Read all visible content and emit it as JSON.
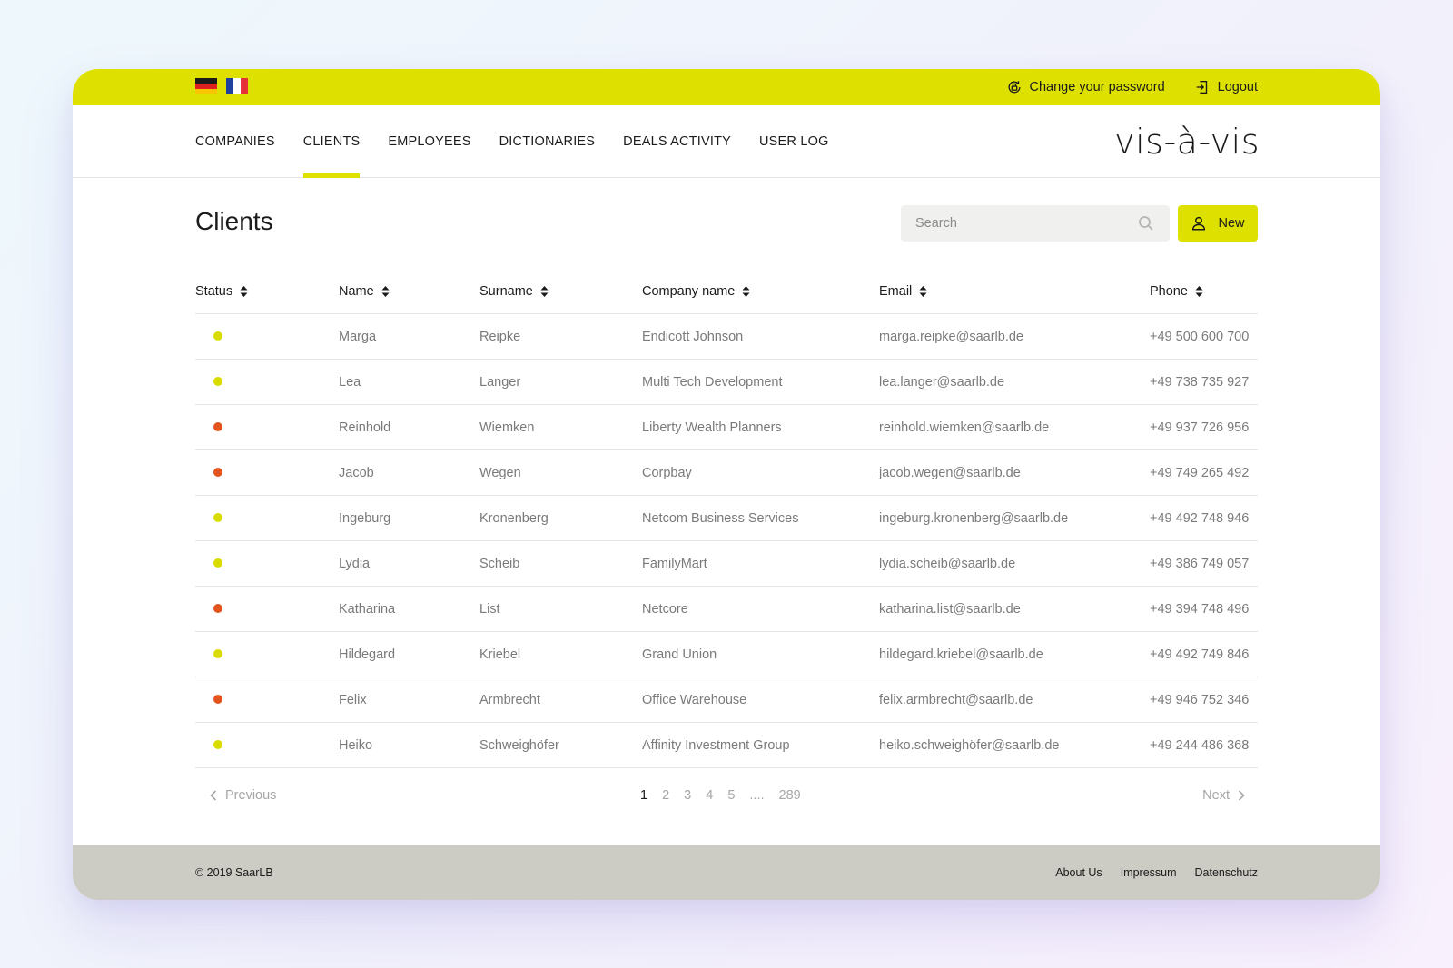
{
  "colors": {
    "accent": "#dee100",
    "status_active": "#d9dc00",
    "status_inactive": "#e2541e",
    "footer_bg": "#cccbc4",
    "muted_text": "#7a7a7a"
  },
  "topbar": {
    "languages": [
      {
        "code": "de",
        "icon": "german-flag-icon"
      },
      {
        "code": "fr",
        "icon": "french-flag-icon"
      }
    ],
    "change_password_label": "Change your password",
    "change_password_icon": "lock-refresh-icon",
    "logout_label": "Logout",
    "logout_icon": "logout-icon"
  },
  "nav": {
    "items": [
      "COMPANIES",
      "CLIENTS",
      "EMPLOYEES",
      "DICTIONARIES",
      "DEALS ACTIVITY",
      "USER LOG"
    ],
    "active": "CLIENTS"
  },
  "logo": "vis-à-vis",
  "page": {
    "title": "Clients",
    "search_placeholder": "Search",
    "search_value": "",
    "new_button_label": "New",
    "new_button_icon": "user-icon"
  },
  "table": {
    "columns": [
      "Status",
      "Name",
      "Surname",
      "Company name",
      "Email",
      "Phone"
    ],
    "sort_icon": "sort-icon",
    "rows": [
      {
        "status": "active",
        "name": "Marga",
        "surname": "Reipke",
        "company": "Endicott Johnson",
        "email": "marga.reipke@saarlb.de",
        "phone": "+49 500 600 700"
      },
      {
        "status": "active",
        "name": "Lea",
        "surname": "Langer",
        "company": "Multi Tech Development",
        "email": "lea.langer@saarlb.de",
        "phone": "+49 738 735 927"
      },
      {
        "status": "inactive",
        "name": "Reinhold",
        "surname": "Wiemken",
        "company": "Liberty Wealth Planners",
        "email": "reinhold.wiemken@saarlb.de",
        "phone": "+49 937 726 956"
      },
      {
        "status": "inactive",
        "name": "Jacob",
        "surname": "Wegen",
        "company": "Corpbay",
        "email": "jacob.wegen@saarlb.de",
        "phone": "+49 749 265 492"
      },
      {
        "status": "active",
        "name": "Ingeburg",
        "surname": "Kronenberg",
        "company": "Netcom Business Services",
        "email": "ingeburg.kronenberg@saarlb.de",
        "phone": "+49 492 748 946"
      },
      {
        "status": "active",
        "name": "Lydia",
        "surname": "Scheib",
        "company": "FamilyMart",
        "email": "lydia.scheib@saarlb.de",
        "phone": "+49 386 749 057"
      },
      {
        "status": "inactive",
        "name": "Katharina",
        "surname": "List",
        "company": "Netcore",
        "email": "katharina.list@saarlb.de",
        "phone": "+49 394 748 496"
      },
      {
        "status": "active",
        "name": "Hildegard",
        "surname": "Kriebel",
        "company": "Grand Union",
        "email": "hildegard.kriebel@saarlb.de",
        "phone": "+49 492 749 846"
      },
      {
        "status": "inactive",
        "name": "Felix",
        "surname": "Armbrecht",
        "company": "Office Warehouse",
        "email": "felix.armbrecht@saarlb.de",
        "phone": "+49 946 752 346"
      },
      {
        "status": "active",
        "name": "Heiko",
        "surname": "Schweighöfer",
        "company": "Affinity Investment Group",
        "email": "heiko.schweighöfer@saarlb.de",
        "phone": "+49 244 486 368"
      }
    ]
  },
  "pagination": {
    "previous_label": "Previous",
    "next_label": "Next",
    "pages": [
      "1",
      "2",
      "3",
      "4",
      "5",
      "....",
      "289"
    ],
    "current": "1"
  },
  "footer": {
    "copyright": "© 2019 SaarLB",
    "links": [
      "About Us",
      "Impressum",
      "Datenschutz"
    ]
  }
}
